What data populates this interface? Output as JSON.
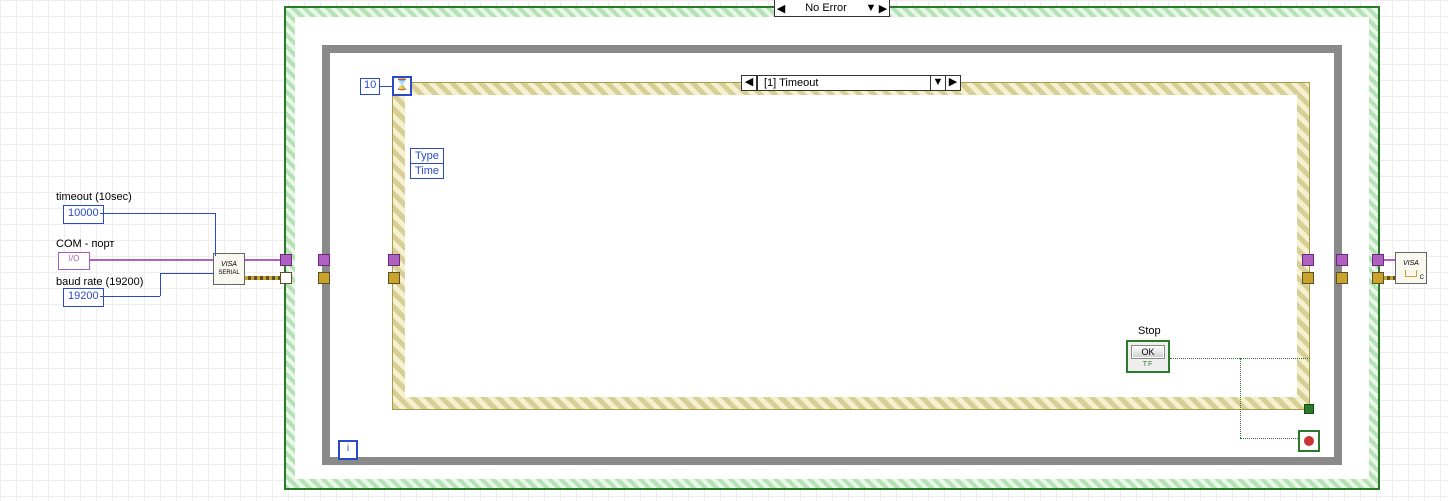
{
  "labels": {
    "timeout_caption": "timeout (10sec)",
    "com_caption": "COM - порт",
    "baud_caption": "baud rate (19200)",
    "stop_caption": "Stop"
  },
  "constants": {
    "timeout_ms": "10000",
    "baud_rate": "19200",
    "event_timeout": "10"
  },
  "visa": {
    "resource_ctrl": "I/O",
    "serial_icon_top": "VISA",
    "serial_icon_sub": "SERIAL",
    "close_icon_top": "VISA",
    "close_icon_sub": "C"
  },
  "case": {
    "visible": "No Error"
  },
  "event": {
    "visible": "[1] Timeout",
    "hourglass": "⌛",
    "data_node": {
      "row0": "Type",
      "row1": "Time"
    }
  },
  "iter_glyph": "i",
  "stop_button_face": "OK",
  "stop_button_tf": "TF",
  "arrows": {
    "left": "◀",
    "right": "▶",
    "down": "▼"
  }
}
